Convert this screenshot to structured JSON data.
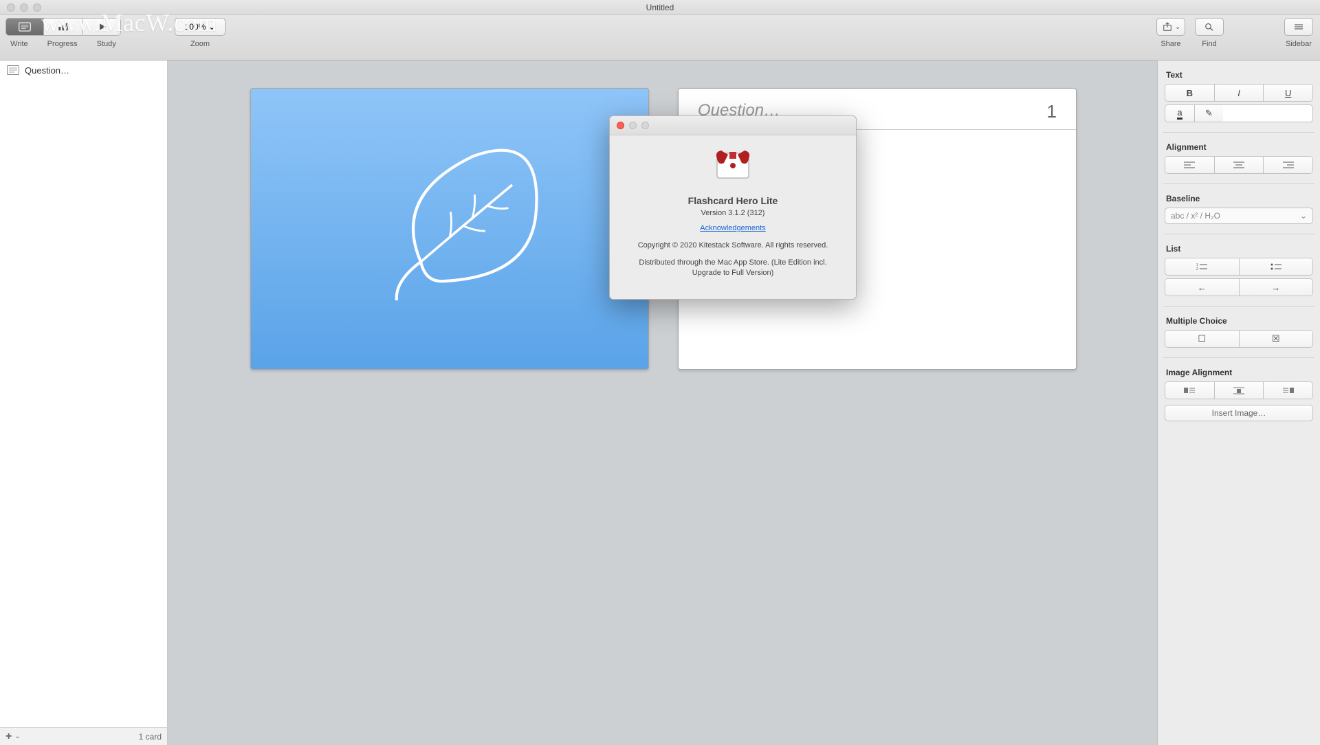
{
  "titlebar": {
    "title": "Untitled"
  },
  "watermark": "www.MacW.com",
  "toolbar": {
    "tabs": {
      "write": "Write",
      "progress": "Progress",
      "study": "Study"
    },
    "zoom": {
      "label": "Zoom",
      "value": "100%"
    },
    "right": {
      "share": "Share",
      "find": "Find",
      "sidebar": "Sidebar"
    }
  },
  "sidebar": {
    "items": [
      {
        "label": "Question…"
      }
    ],
    "footer": {
      "count": "1 card"
    }
  },
  "canvas": {
    "question_placeholder": "Question…",
    "card_number": "1"
  },
  "inspector": {
    "text": "Text",
    "alignment": "Alignment",
    "baseline": "Baseline",
    "baseline_value": "abc  /  x²  /  H₂O",
    "list": "List",
    "multiple_choice": "Multiple Choice",
    "image_alignment": "Image Alignment",
    "insert_image": "Insert Image…"
  },
  "about": {
    "app_name": "Flashcard Hero Lite",
    "version": "Version 3.1.2 (312)",
    "ack": "Acknowledgements",
    "copyright": "Copyright © 2020 Kitestack Software. All rights reserved.",
    "distribution": "Distributed through the Mac App Store. (Lite Edition incl. Upgrade to Full Version)"
  }
}
